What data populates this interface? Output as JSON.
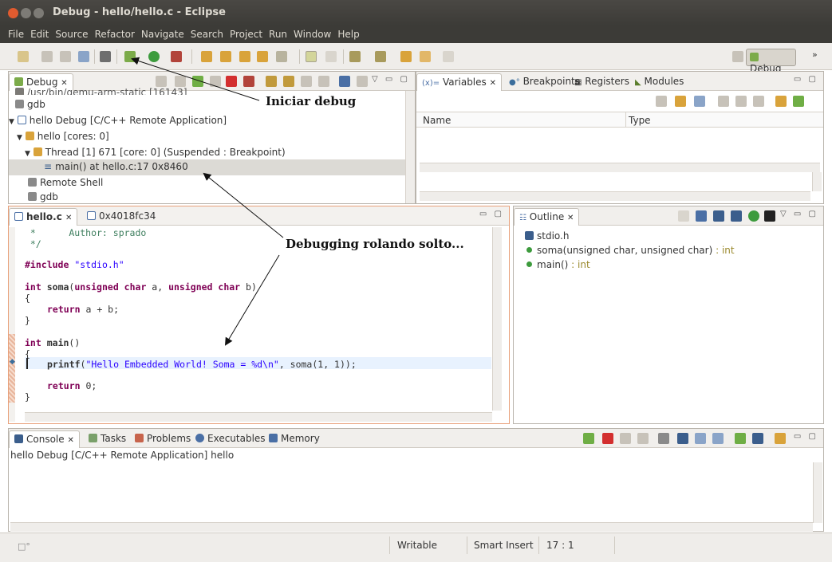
{
  "window": {
    "title": "Debug - hello/hello.c - Eclipse"
  },
  "menu": [
    "File",
    "Edit",
    "Source",
    "Refactor",
    "Navigate",
    "Search",
    "Project",
    "Run",
    "Window",
    "Help"
  ],
  "perspective": {
    "label": "Debug",
    "chevron": "»"
  },
  "debug_view": {
    "tab": "Debug",
    "rows": [
      {
        "label": "/usr/bin/qemu-arm-static [16143]",
        "icon": "process-icon"
      },
      {
        "label": "gdb",
        "icon": "gdb-icon"
      },
      {
        "label": "hello Debug [C/C++ Remote Application]",
        "icon": "launch-icon"
      },
      {
        "label": "hello [cores: 0]",
        "icon": "app-icon"
      },
      {
        "label": "Thread [1] 671 [core: 0] (Suspended : Breakpoint)",
        "icon": "thread-icon"
      },
      {
        "label": "main() at hello.c:17 0x8460",
        "icon": "stackframe-icon"
      },
      {
        "label": "Remote Shell",
        "icon": "shell-icon"
      },
      {
        "label": "gdb",
        "icon": "gdb-icon"
      }
    ]
  },
  "variables_view": {
    "tabs": [
      "Variables",
      "Breakpoints",
      "Registers",
      "Modules"
    ],
    "columns": [
      "Name",
      "Type"
    ]
  },
  "editor": {
    "tabs": [
      "hello.c",
      "0x4018fc34"
    ],
    "author_line": " *      Author: sprado",
    "comment_end": " */",
    "include_kw": "#include",
    "include_file": "\"stdio.h\"",
    "soma_sig_kw1": "int",
    "soma_name": "soma",
    "soma_sig_kw2": "unsigned char",
    "soma_a": " a, ",
    "soma_kw3": "unsigned char",
    "soma_b": " b)",
    "brace_open": "{",
    "return_kw": "return",
    "return_expr": " a + b;",
    "brace_close": "}",
    "main_kw": "int",
    "main_name": "main",
    "main_parens": "()",
    "printf_name": "printf",
    "printf_str": "\"Hello Embedded World! Soma = %d\\n\"",
    "printf_rest": ", soma(1, 1));",
    "return0": " 0;"
  },
  "outline": {
    "tab": "Outline",
    "items": [
      {
        "label": "stdio.h",
        "type": ""
      },
      {
        "label": "soma(unsigned char, unsigned char)",
        "type": " : int"
      },
      {
        "label": "main()",
        "type": " : int"
      }
    ]
  },
  "console": {
    "tabs": [
      "Console",
      "Tasks",
      "Problems",
      "Executables",
      "Memory"
    ],
    "header": "hello Debug [C/C++ Remote Application] hello"
  },
  "status": {
    "writable": "Writable",
    "insert": "Smart Insert",
    "position": "17 : 1"
  },
  "annotations": {
    "start": "Iniciar debug",
    "running": "Debugging rolando solto..."
  }
}
